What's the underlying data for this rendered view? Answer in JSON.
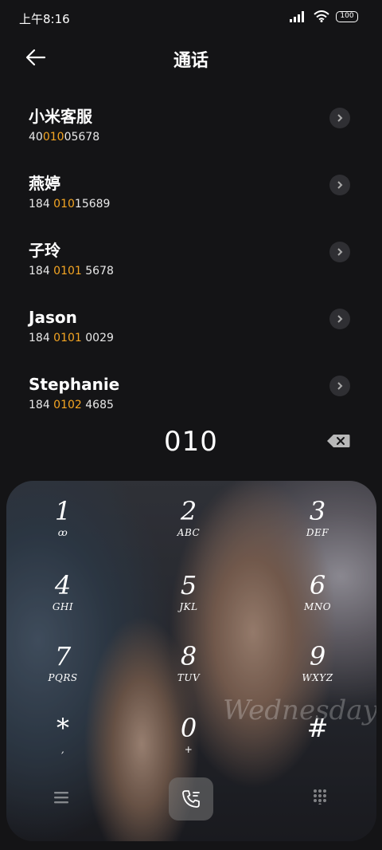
{
  "status": {
    "time": "上午8:16",
    "battery": "100",
    "icons": [
      "signal-icon",
      "wifi-icon",
      "battery-icon"
    ]
  },
  "header": {
    "title": "通话",
    "back_icon": "arrow-left-icon"
  },
  "contacts": [
    {
      "name": "小米客服",
      "num_pre": "40",
      "num_hl": "010",
      "num_post": "05678"
    },
    {
      "name": "燕婷",
      "num_pre": "184 ",
      "num_hl": "010",
      "num_post": "15689"
    },
    {
      "name": "子玲",
      "num_pre": "184 ",
      "num_hl": "0101",
      "num_post": " 5678"
    },
    {
      "name": "Jason",
      "num_pre": "184 ",
      "num_hl": "0101",
      "num_post": " 0029"
    },
    {
      "name": "Stephanie",
      "num_pre": "184 ",
      "num_hl": "0102",
      "num_post": " 4685"
    }
  ],
  "dial": {
    "number": "010"
  },
  "keypad": {
    "watermark": "Wednesday",
    "keys": [
      {
        "digit": "1",
        "letters": "ꝏ"
      },
      {
        "digit": "2",
        "letters": "ABC"
      },
      {
        "digit": "3",
        "letters": "DEF"
      },
      {
        "digit": "4",
        "letters": "GHI"
      },
      {
        "digit": "5",
        "letters": "JKL"
      },
      {
        "digit": "6",
        "letters": "MNO"
      },
      {
        "digit": "7",
        "letters": "PQRS"
      },
      {
        "digit": "8",
        "letters": "TUV"
      },
      {
        "digit": "9",
        "letters": "WXYZ"
      },
      {
        "digit": "*",
        "letters": ","
      },
      {
        "digit": "0",
        "letters": "+"
      },
      {
        "digit": "#",
        "letters": ""
      }
    ]
  },
  "colors": {
    "accent": "#f5a623",
    "background": "#141416"
  }
}
